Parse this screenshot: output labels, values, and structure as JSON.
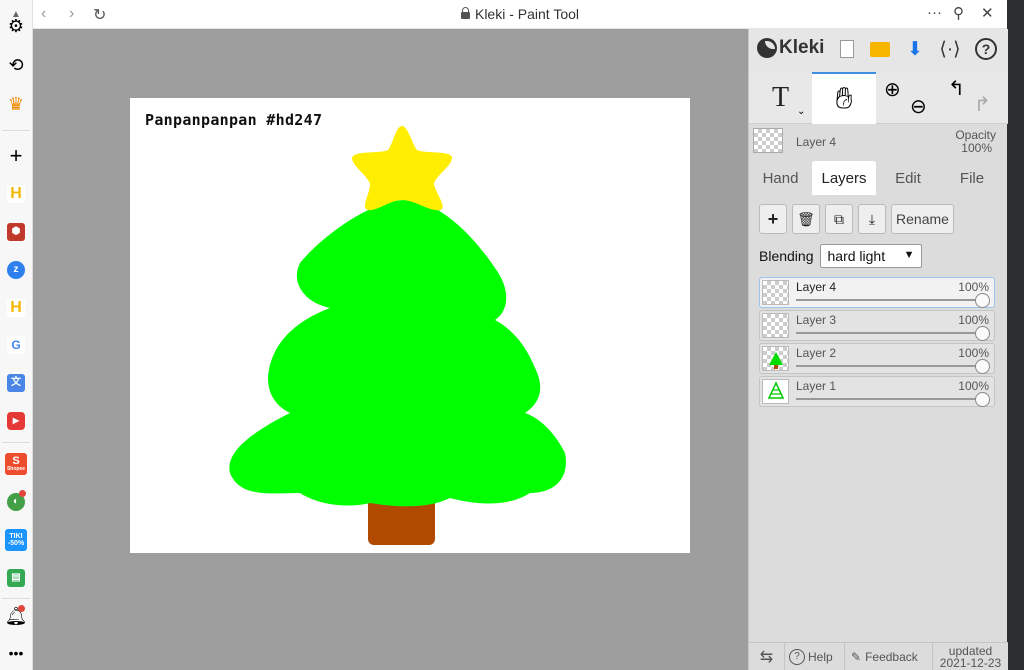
{
  "window": {
    "title": "Kleki - Paint Tool"
  },
  "sidebar": {
    "items": [
      {
        "name": "settings-icon"
      },
      {
        "name": "history-icon"
      },
      {
        "name": "crown-icon",
        "color": "#f08a00"
      },
      {
        "name": "add-icon"
      },
      {
        "name": "hotel-icon",
        "color": "#f2b705"
      },
      {
        "name": "shield-icon",
        "color": "#c0392b"
      },
      {
        "name": "zalo-icon",
        "color": "#2f80ed"
      },
      {
        "name": "hotel-icon",
        "color": "#f2b705"
      },
      {
        "name": "google-icon"
      },
      {
        "name": "translate-icon",
        "color": "#4a86e8"
      },
      {
        "name": "youtube-icon",
        "color": "#e53935"
      },
      {
        "name": "shopee-icon",
        "color": "#ee4d2d",
        "label": "Shopee"
      },
      {
        "name": "palette-icon",
        "color": "#43a047"
      },
      {
        "name": "tiki-icon",
        "color": "#1a94ff",
        "label": "TIKI -50%"
      },
      {
        "name": "sheets-icon",
        "color": "#34a853"
      },
      {
        "name": "bell-icon"
      },
      {
        "name": "more-icon"
      }
    ]
  },
  "canvas": {
    "text": "Panpanpanpan #hd247"
  },
  "panel": {
    "app_name": "Kleki",
    "current_layer": "Layer 4",
    "opacity_label": "Opacity",
    "opacity_value": "100%",
    "tabs": [
      "Hand",
      "Layers",
      "Edit",
      "File"
    ],
    "active_tab": "Layers",
    "rename_label": "Rename",
    "blending_label": "Blending",
    "blending_value": "hard light",
    "layers": [
      {
        "name": "Layer 4",
        "opacity": "100%",
        "active": true
      },
      {
        "name": "Layer 3",
        "opacity": "100%",
        "active": false
      },
      {
        "name": "Layer 2",
        "opacity": "100%",
        "active": false
      },
      {
        "name": "Layer 1",
        "opacity": "100%",
        "active": false
      }
    ],
    "footer": {
      "help": "Help",
      "feedback": "Feedback",
      "updated_label": "updated",
      "updated_date": "2021-12-23"
    }
  },
  "colors": {
    "accent": "#3d8fe3",
    "tree_green": "#00ff00",
    "star_yellow": "#ffee00",
    "trunk_brown": "#b04a00",
    "canvas_bg": "#9e9e9e"
  }
}
